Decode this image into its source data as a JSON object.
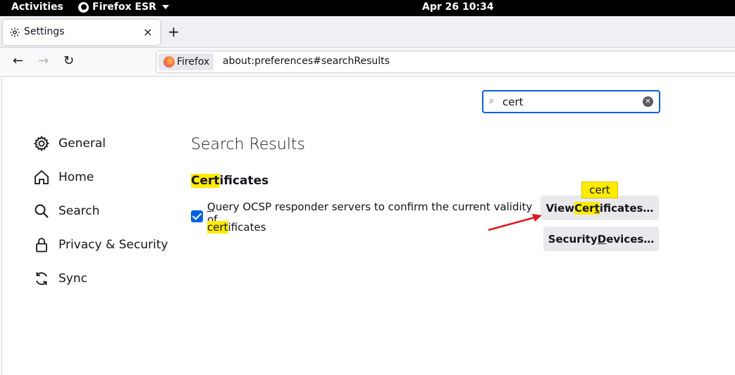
{
  "topbar": {
    "activities": "Activities",
    "app_name": "Firefox ESR",
    "clock": "Apr 26  10:34"
  },
  "tab": {
    "title": "Settings",
    "close": "×",
    "new_tab": "+"
  },
  "nav": {
    "back": "←",
    "forward": "→",
    "reload": "↻",
    "identity_label": "Firefox",
    "url": "about:preferences#searchResults"
  },
  "search": {
    "value": "cert",
    "icon": "search-icon"
  },
  "sidebar": {
    "items": [
      {
        "label": "General",
        "icon": "gear-icon"
      },
      {
        "label": "Home",
        "icon": "home-icon"
      },
      {
        "label": "Search",
        "icon": "search-icon"
      },
      {
        "label": "Privacy & Security",
        "icon": "lock-icon"
      },
      {
        "label": "Sync",
        "icon": "sync-icon"
      }
    ]
  },
  "main": {
    "results_title": "Search Results",
    "section": {
      "highlight": "Cert",
      "rest": "ificates"
    },
    "ocsp": {
      "line1_key": "Q",
      "line1_rest": "uery OCSP responder servers to confirm the current validity of",
      "line2_highlight": "cert",
      "line2_rest": "ificates",
      "checked": true
    },
    "view_button": {
      "pre": "View ",
      "highlight": "Cer",
      "underline": "t",
      "rest": "ificates…"
    },
    "security_button": {
      "pre": "Security ",
      "underline": "D",
      "rest": "evices…"
    },
    "tooltip": "cert"
  },
  "colors": {
    "highlight": "#ffeb00",
    "accent": "#0061e0",
    "arrow": "#e0191f"
  }
}
